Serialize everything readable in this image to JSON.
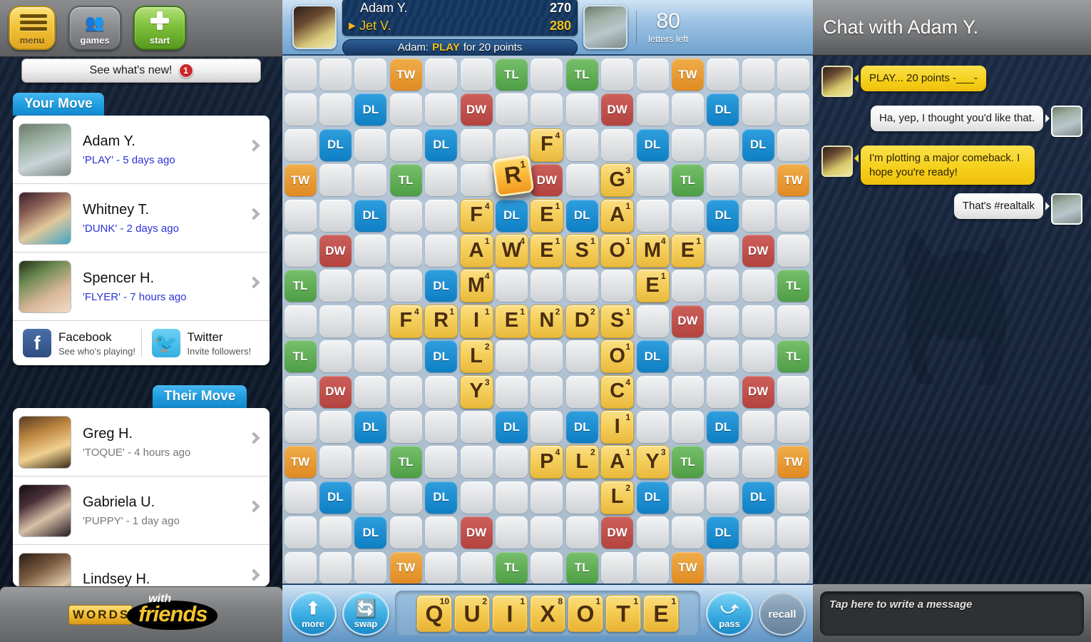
{
  "toolbar": {
    "menu_label": "menu",
    "games_label": "games",
    "start_label": "start",
    "whats_new_label": "See what's new!",
    "whats_new_badge": "1"
  },
  "sections": {
    "your_move_label": "Your Move",
    "their_move_label": "Their Move"
  },
  "your_move": [
    {
      "name": "Adam Y.",
      "move": "'PLAY' - 5 days ago",
      "tone": "blue"
    },
    {
      "name": "Whitney T.",
      "move": "'DUNK' - 2 days ago",
      "tone": "blue"
    },
    {
      "name": "Spencer H.",
      "move": "'FLYER' - 7 hours ago",
      "tone": "blue"
    }
  ],
  "their_move": [
    {
      "name": "Greg H.",
      "move": "'TOQUE' - 4 hours ago",
      "tone": "gray"
    },
    {
      "name": "Gabriela U.",
      "move": "'PUPPY' - 1 day ago",
      "tone": "gray"
    },
    {
      "name": "Lindsey H.",
      "move": "",
      "tone": "gray"
    }
  ],
  "social": {
    "facebook_title": "Facebook",
    "facebook_sub": "See who's playing!",
    "facebook_icon": "facebook-f-icon",
    "twitter_title": "Twitter",
    "twitter_sub": "Invite followers!",
    "twitter_icon": "twitter-bird-icon"
  },
  "logo": {
    "words": [
      "W",
      "O",
      "R",
      "D",
      "S"
    ],
    "with": "with",
    "friends": "friends"
  },
  "game_header": {
    "player_opponent": "Adam Y.",
    "score_opponent": "270",
    "player_self": "Jet V.",
    "score_self": "280",
    "turn_marker": "▶",
    "last_move_prefix": "Adam:",
    "last_move_word": "PLAY",
    "last_move_suffix": "for 20 points",
    "letters_left_count": "80",
    "letters_left_label": "letters left"
  },
  "board": {
    "size": 15,
    "bonuses": [
      {
        "r": 0,
        "c": 3,
        "t": "TW"
      },
      {
        "r": 0,
        "c": 6,
        "t": "TL"
      },
      {
        "r": 0,
        "c": 8,
        "t": "TL"
      },
      {
        "r": 0,
        "c": 11,
        "t": "TW"
      },
      {
        "r": 1,
        "c": 2,
        "t": "DL"
      },
      {
        "r": 1,
        "c": 5,
        "t": "DW"
      },
      {
        "r": 1,
        "c": 9,
        "t": "DW"
      },
      {
        "r": 1,
        "c": 12,
        "t": "DL"
      },
      {
        "r": 2,
        "c": 1,
        "t": "DL"
      },
      {
        "r": 2,
        "c": 4,
        "t": "DL"
      },
      {
        "r": 2,
        "c": 10,
        "t": "DL"
      },
      {
        "r": 2,
        "c": 13,
        "t": "DL"
      },
      {
        "r": 3,
        "c": 0,
        "t": "TW"
      },
      {
        "r": 3,
        "c": 3,
        "t": "TL"
      },
      {
        "r": 3,
        "c": 7,
        "t": "DW"
      },
      {
        "r": 3,
        "c": 11,
        "t": "TL"
      },
      {
        "r": 3,
        "c": 14,
        "t": "TW"
      },
      {
        "r": 4,
        "c": 2,
        "t": "DL"
      },
      {
        "r": 4,
        "c": 6,
        "t": "DL"
      },
      {
        "r": 4,
        "c": 8,
        "t": "DL"
      },
      {
        "r": 4,
        "c": 12,
        "t": "DL"
      },
      {
        "r": 5,
        "c": 1,
        "t": "DW"
      },
      {
        "r": 5,
        "c": 13,
        "t": "DW"
      },
      {
        "r": 6,
        "c": 0,
        "t": "TL"
      },
      {
        "r": 6,
        "c": 4,
        "t": "DL"
      },
      {
        "r": 6,
        "c": 14,
        "t": "TL"
      },
      {
        "r": 7,
        "c": 11,
        "t": "DW"
      },
      {
        "r": 8,
        "c": 0,
        "t": "TL"
      },
      {
        "r": 8,
        "c": 4,
        "t": "DL"
      },
      {
        "r": 8,
        "c": 10,
        "t": "DL"
      },
      {
        "r": 8,
        "c": 14,
        "t": "TL"
      },
      {
        "r": 9,
        "c": 1,
        "t": "DW"
      },
      {
        "r": 9,
        "c": 13,
        "t": "DW"
      },
      {
        "r": 10,
        "c": 2,
        "t": "DL"
      },
      {
        "r": 10,
        "c": 6,
        "t": "DL"
      },
      {
        "r": 10,
        "c": 8,
        "t": "DL"
      },
      {
        "r": 10,
        "c": 12,
        "t": "DL"
      },
      {
        "r": 11,
        "c": 0,
        "t": "TW"
      },
      {
        "r": 11,
        "c": 3,
        "t": "TL"
      },
      {
        "r": 11,
        "c": 11,
        "t": "TL"
      },
      {
        "r": 11,
        "c": 14,
        "t": "TW"
      },
      {
        "r": 12,
        "c": 1,
        "t": "DL"
      },
      {
        "r": 12,
        "c": 4,
        "t": "DL"
      },
      {
        "r": 12,
        "c": 10,
        "t": "DL"
      },
      {
        "r": 12,
        "c": 13,
        "t": "DL"
      },
      {
        "r": 13,
        "c": 2,
        "t": "DL"
      },
      {
        "r": 13,
        "c": 5,
        "t": "DW"
      },
      {
        "r": 13,
        "c": 9,
        "t": "DW"
      },
      {
        "r": 13,
        "c": 12,
        "t": "DL"
      },
      {
        "r": 14,
        "c": 3,
        "t": "TW"
      },
      {
        "r": 14,
        "c": 6,
        "t": "TL"
      },
      {
        "r": 14,
        "c": 8,
        "t": "TL"
      },
      {
        "r": 14,
        "c": 11,
        "t": "TW"
      }
    ],
    "tiles": [
      {
        "r": 2,
        "c": 7,
        "L": "F",
        "P": "4"
      },
      {
        "r": 3,
        "c": 9,
        "L": "G",
        "P": "3"
      },
      {
        "r": 4,
        "c": 5,
        "L": "F",
        "P": "4"
      },
      {
        "r": 4,
        "c": 7,
        "L": "E",
        "P": "1"
      },
      {
        "r": 4,
        "c": 9,
        "L": "A",
        "P": "1"
      },
      {
        "r": 5,
        "c": 5,
        "L": "A",
        "P": "1"
      },
      {
        "r": 5,
        "c": 6,
        "L": "W",
        "P": "4"
      },
      {
        "r": 5,
        "c": 7,
        "L": "E",
        "P": "1"
      },
      {
        "r": 5,
        "c": 8,
        "L": "S",
        "P": "1"
      },
      {
        "r": 5,
        "c": 9,
        "L": "O",
        "P": "1"
      },
      {
        "r": 5,
        "c": 10,
        "L": "M",
        "P": "4"
      },
      {
        "r": 5,
        "c": 11,
        "L": "E",
        "P": "1"
      },
      {
        "r": 6,
        "c": 5,
        "L": "M",
        "P": "4"
      },
      {
        "r": 6,
        "c": 10,
        "L": "E",
        "P": "1"
      },
      {
        "r": 7,
        "c": 3,
        "L": "F",
        "P": "4"
      },
      {
        "r": 7,
        "c": 4,
        "L": "R",
        "P": "1"
      },
      {
        "r": 7,
        "c": 5,
        "L": "I",
        "P": "1"
      },
      {
        "r": 7,
        "c": 6,
        "L": "E",
        "P": "1"
      },
      {
        "r": 7,
        "c": 7,
        "L": "N",
        "P": "2"
      },
      {
        "r": 7,
        "c": 8,
        "L": "D",
        "P": "2"
      },
      {
        "r": 7,
        "c": 9,
        "L": "S",
        "P": "1"
      },
      {
        "r": 8,
        "c": 5,
        "L": "L",
        "P": "2"
      },
      {
        "r": 8,
        "c": 9,
        "L": "O",
        "P": "1"
      },
      {
        "r": 9,
        "c": 5,
        "L": "Y",
        "P": "3"
      },
      {
        "r": 9,
        "c": 9,
        "L": "C",
        "P": "4"
      },
      {
        "r": 10,
        "c": 9,
        "L": "I",
        "P": "1"
      },
      {
        "r": 11,
        "c": 7,
        "L": "P",
        "P": "4"
      },
      {
        "r": 11,
        "c": 8,
        "L": "L",
        "P": "2"
      },
      {
        "r": 11,
        "c": 9,
        "L": "A",
        "P": "1"
      },
      {
        "r": 11,
        "c": 10,
        "L": "Y",
        "P": "3"
      },
      {
        "r": 12,
        "c": 9,
        "L": "L",
        "P": "2"
      }
    ],
    "dragging_tile": {
      "L": "R",
      "P": "1"
    }
  },
  "rack": {
    "more_label": "more",
    "swap_label": "swap",
    "pass_label": "pass",
    "recall_label": "recall",
    "more_icon": "arrow-up-icon",
    "swap_icon": "swap-tiles-icon",
    "pass_icon": "curved-arrow-icon",
    "recall_icon": "recall-loop-icon",
    "tiles": [
      {
        "L": "Q",
        "P": "10"
      },
      {
        "L": "U",
        "P": "2"
      },
      {
        "L": "I",
        "P": "1"
      },
      {
        "L": "X",
        "P": "8"
      },
      {
        "L": "O",
        "P": "1"
      },
      {
        "L": "T",
        "P": "1"
      },
      {
        "L": "E",
        "P": "1"
      }
    ]
  },
  "chat": {
    "title": "Chat with Adam Y.",
    "messages": [
      {
        "side": "them",
        "text": "PLAY... 20 points -___-"
      },
      {
        "side": "me",
        "text": "Ha, yep, I thought you'd like that."
      },
      {
        "side": "them",
        "text": "I'm plotting a major comeback. I hope you're ready!"
      },
      {
        "side": "me",
        "text": "That's #realtalk"
      }
    ],
    "input_placeholder": "Tap here to write a message",
    "watermark_icon": "dog-silhouette-icon"
  },
  "colors": {
    "tw": "#e08a22",
    "dw": "#b4433f",
    "tl": "#4e9e45",
    "dl": "#0e7fc4",
    "tile": "#f5cf5c",
    "accent_blue": "#1f9fe2",
    "chat_yellow": "#f5cf18"
  }
}
